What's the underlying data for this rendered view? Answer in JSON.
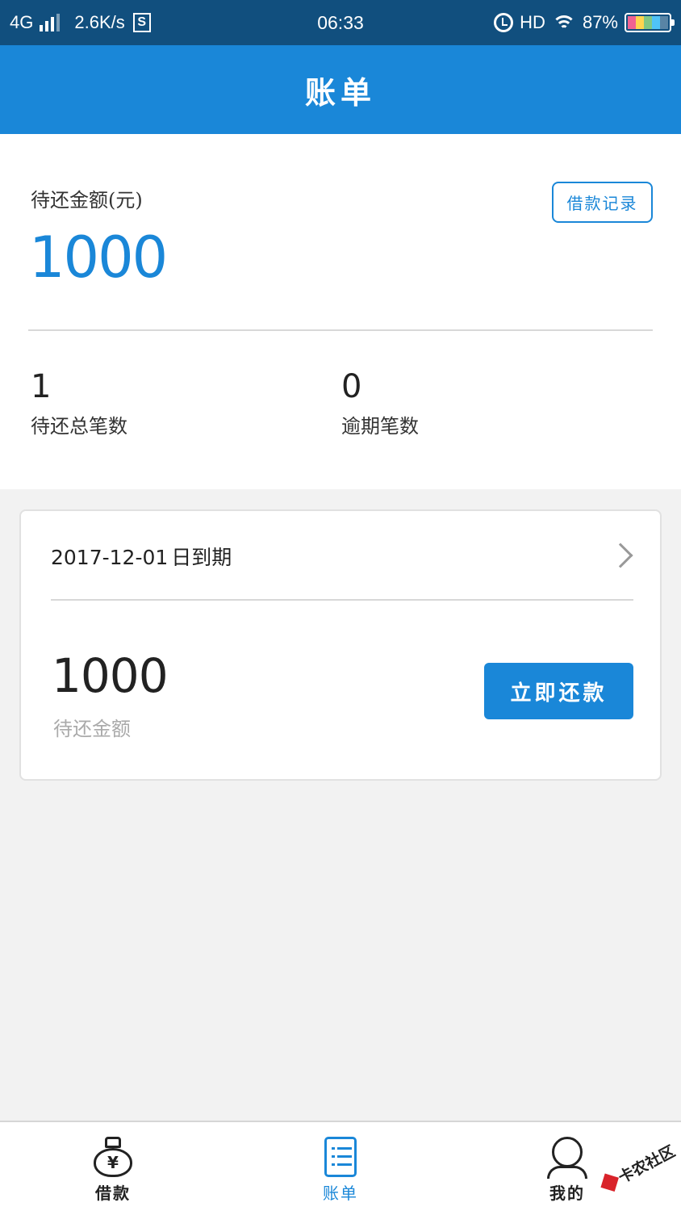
{
  "status_bar": {
    "network": "4G",
    "speed": "2.6K/s",
    "s_badge": "S",
    "time": "06:33",
    "hd": "HD",
    "battery": "87%"
  },
  "header": {
    "title": "账单"
  },
  "summary": {
    "pending_label": "待还金额(元)",
    "pending_amount": "1000",
    "records_button": "借款记录",
    "total_count": "1",
    "total_count_label": "待还总笔数",
    "overdue_count": "0",
    "overdue_count_label": "逾期笔数"
  },
  "bill": {
    "due_date": "2017-12-01",
    "due_suffix": "日到期",
    "amount": "1000",
    "amount_label": "待还金额",
    "repay_button": "立即还款"
  },
  "tabs": [
    {
      "label": "借款",
      "icon": "money-bag-icon",
      "active": false
    },
    {
      "label": "账单",
      "icon": "bill-list-icon",
      "active": true
    },
    {
      "label": "我的",
      "icon": "user-icon",
      "active": false
    }
  ],
  "watermark": {
    "text": "卡农社区"
  },
  "colors": {
    "accent": "#1a87d8",
    "status_bar": "#114f7e",
    "background": "#f2f2f2"
  }
}
